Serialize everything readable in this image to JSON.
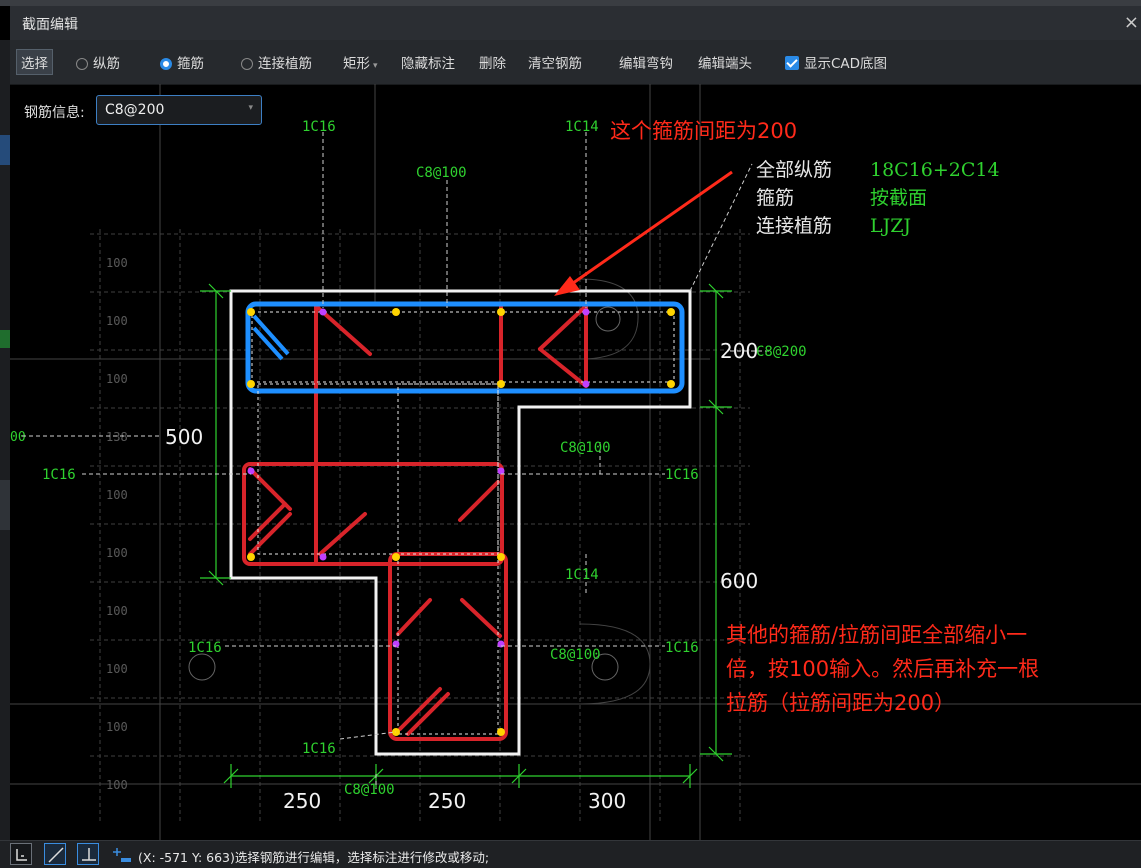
{
  "window": {
    "title": "截面编辑",
    "close_glyph": "×"
  },
  "toolbar": {
    "select": "选择",
    "radio_longitudinal": "纵筋",
    "radio_stirrup": "箍筋",
    "radio_anchor": "连接植筋",
    "shape_dropdown": "矩形",
    "hide_dims": "隐藏标注",
    "delete": "删除",
    "clear_rebar": "清空钢筋",
    "edit_hook": "编辑弯钩",
    "edit_end": "编辑端头",
    "show_cad": "显示CAD底图",
    "selected_radio": "stirrup",
    "show_cad_checked": true
  },
  "rebar_info": {
    "label": "钢筋信息:",
    "value": "C8@200"
  },
  "drawing": {
    "top_labels": [
      "1C16",
      "1C14",
      "C8@100"
    ],
    "annotation_top": "这个箍筋间距为200",
    "legend": [
      {
        "key": "全部纵筋",
        "value": "18C16+2C14"
      },
      {
        "key": "箍筋",
        "value": "按截面"
      },
      {
        "key": "连接植筋",
        "value": "LJZJ"
      }
    ],
    "annotation_bottom_lines": [
      "其他的箍筋/拉筋间距全部缩小一",
      "倍，按100输入。然后再补充一根",
      "拉筋（拉筋间距为200）"
    ],
    "dims": {
      "left_500": "500",
      "right_200": "200",
      "right_600": "600",
      "bottom": [
        "250",
        "250",
        "300"
      ]
    },
    "labels": {
      "c8_200_right": "C8@200",
      "c8_100_mid": "C8@100",
      "c8_100_lower": "C8@100",
      "c8_100_bottom": "C8@100",
      "c14_mid": "1C14",
      "c16_left": "1C16",
      "c16_right": "1C16",
      "c16_lowleft": "1C16",
      "c16_lowright": "1C16",
      "c16_bottom": "1C16"
    },
    "grid_100_labels": [
      "100",
      "100",
      "100",
      "100",
      "100",
      "100",
      "100",
      "100",
      "100",
      "100"
    ],
    "left_cut_text": "00",
    "cut_138": "138"
  },
  "statusbar": {
    "text": "(X: -571 Y: 663)选择钢筋进行编辑，选择标注进行修改或移动;"
  },
  "colors": {
    "stirrup_blue": "#1e8fff",
    "rebar_red": "#d8242a",
    "dim_green": "#2fd12f",
    "annotation_red": "#ff2a1a",
    "outline_white": "#f2f2f2",
    "accent": "#2a8ae6"
  }
}
